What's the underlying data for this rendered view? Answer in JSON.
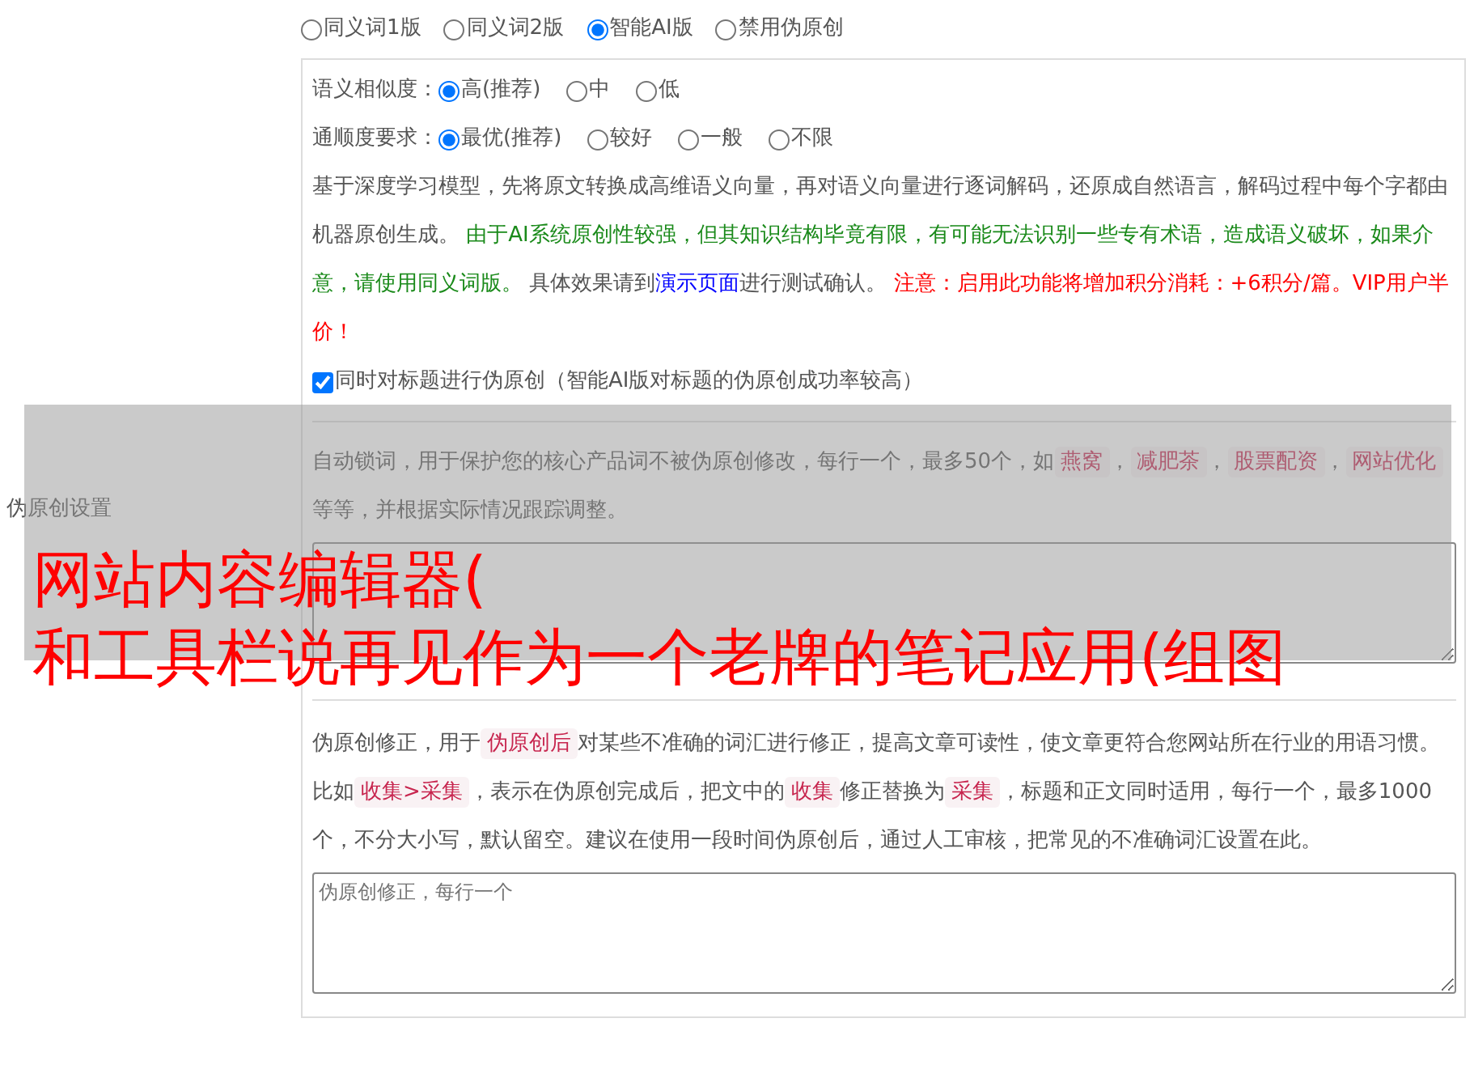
{
  "section_label": "伪原创设置",
  "modes": [
    {
      "label": "同义词1版",
      "selected": false
    },
    {
      "label": "同义词2版",
      "selected": false
    },
    {
      "label": "智能AI版",
      "selected": true
    },
    {
      "label": "禁用伪原创",
      "selected": false
    }
  ],
  "similarity": {
    "label": "语义相似度：",
    "options": [
      {
        "label": "高(推荐)",
        "selected": true
      },
      {
        "label": "中",
        "selected": false
      },
      {
        "label": "低",
        "selected": false
      }
    ]
  },
  "fluency": {
    "label": "通顺度要求：",
    "options": [
      {
        "label": "最优(推荐)",
        "selected": true
      },
      {
        "label": "较好",
        "selected": false
      },
      {
        "label": "一般",
        "selected": false
      },
      {
        "label": "不限",
        "selected": false
      }
    ]
  },
  "description": [
    {
      "kind": "text",
      "text": "基于深度学习模型，先将原文转换成高维语义向量，再对语义向量进行逐词解码，还原成自然语言，解码过程中每个字都由机器原创生成。 "
    },
    {
      "kind": "green",
      "text": "由于AI系统原创性较强，但其知识结构毕竟有限，有可能无法识别一些专有术语，造成语义破坏，如果介意，请使用同义词版。"
    },
    {
      "kind": "text",
      "text": " 具体效果请到"
    },
    {
      "kind": "link",
      "text": "演示页面"
    },
    {
      "kind": "text",
      "text": "进行测试确认。 "
    },
    {
      "kind": "red",
      "text": "注意：启用此功能将增加积分消耗：+6积分/篇。VIP用户半价！"
    }
  ],
  "title_option": {
    "label": "同时对标题进行伪原创（智能AI版对标题的伪原创成功率较高）",
    "checked": true
  },
  "lock_words": {
    "help": [
      {
        "kind": "text",
        "text": "自动锁词，用于保护您的核心产品词不被伪原创修改，每行一个，最多50个，如"
      },
      {
        "kind": "code",
        "text": "燕窝"
      },
      {
        "kind": "text",
        "text": "，"
      },
      {
        "kind": "code",
        "text": "减肥茶"
      },
      {
        "kind": "text",
        "text": "，"
      },
      {
        "kind": "code",
        "text": "股票配资"
      },
      {
        "kind": "text",
        "text": "，"
      },
      {
        "kind": "code",
        "text": "网站优化"
      },
      {
        "kind": "text",
        "text": " 等等，并根据实际情况跟踪调整。"
      }
    ]
  },
  "corrections": {
    "help": [
      {
        "kind": "text",
        "text": "伪原创修正，用于"
      },
      {
        "kind": "code",
        "text": "伪原创后"
      },
      {
        "kind": "text",
        "text": "对某些不准确的词汇进行修正，提高文章可读性，使文章更符合您网站所在行业的用语习惯。比如"
      },
      {
        "kind": "code",
        "text": "收集>采集"
      },
      {
        "kind": "text",
        "text": "，表示在伪原创完成后，把文中的"
      },
      {
        "kind": "code",
        "text": "收集"
      },
      {
        "kind": "text",
        "text": "修正替换为"
      },
      {
        "kind": "code",
        "text": "采集"
      },
      {
        "kind": "text",
        "text": "，标题和正文同时适用，每行一个，最多1000个，不分大小写，默认留空。建议在使用一段时间伪原创后，通过人工审核，把常见的不准确词汇设置在此。"
      }
    ],
    "placeholder": "伪原创修正，每行一个"
  },
  "overlay": {
    "lines": [
      "网站内容编辑器(",
      "和工具栏说再见作为一个老牌的笔记应用(组图"
    ]
  }
}
